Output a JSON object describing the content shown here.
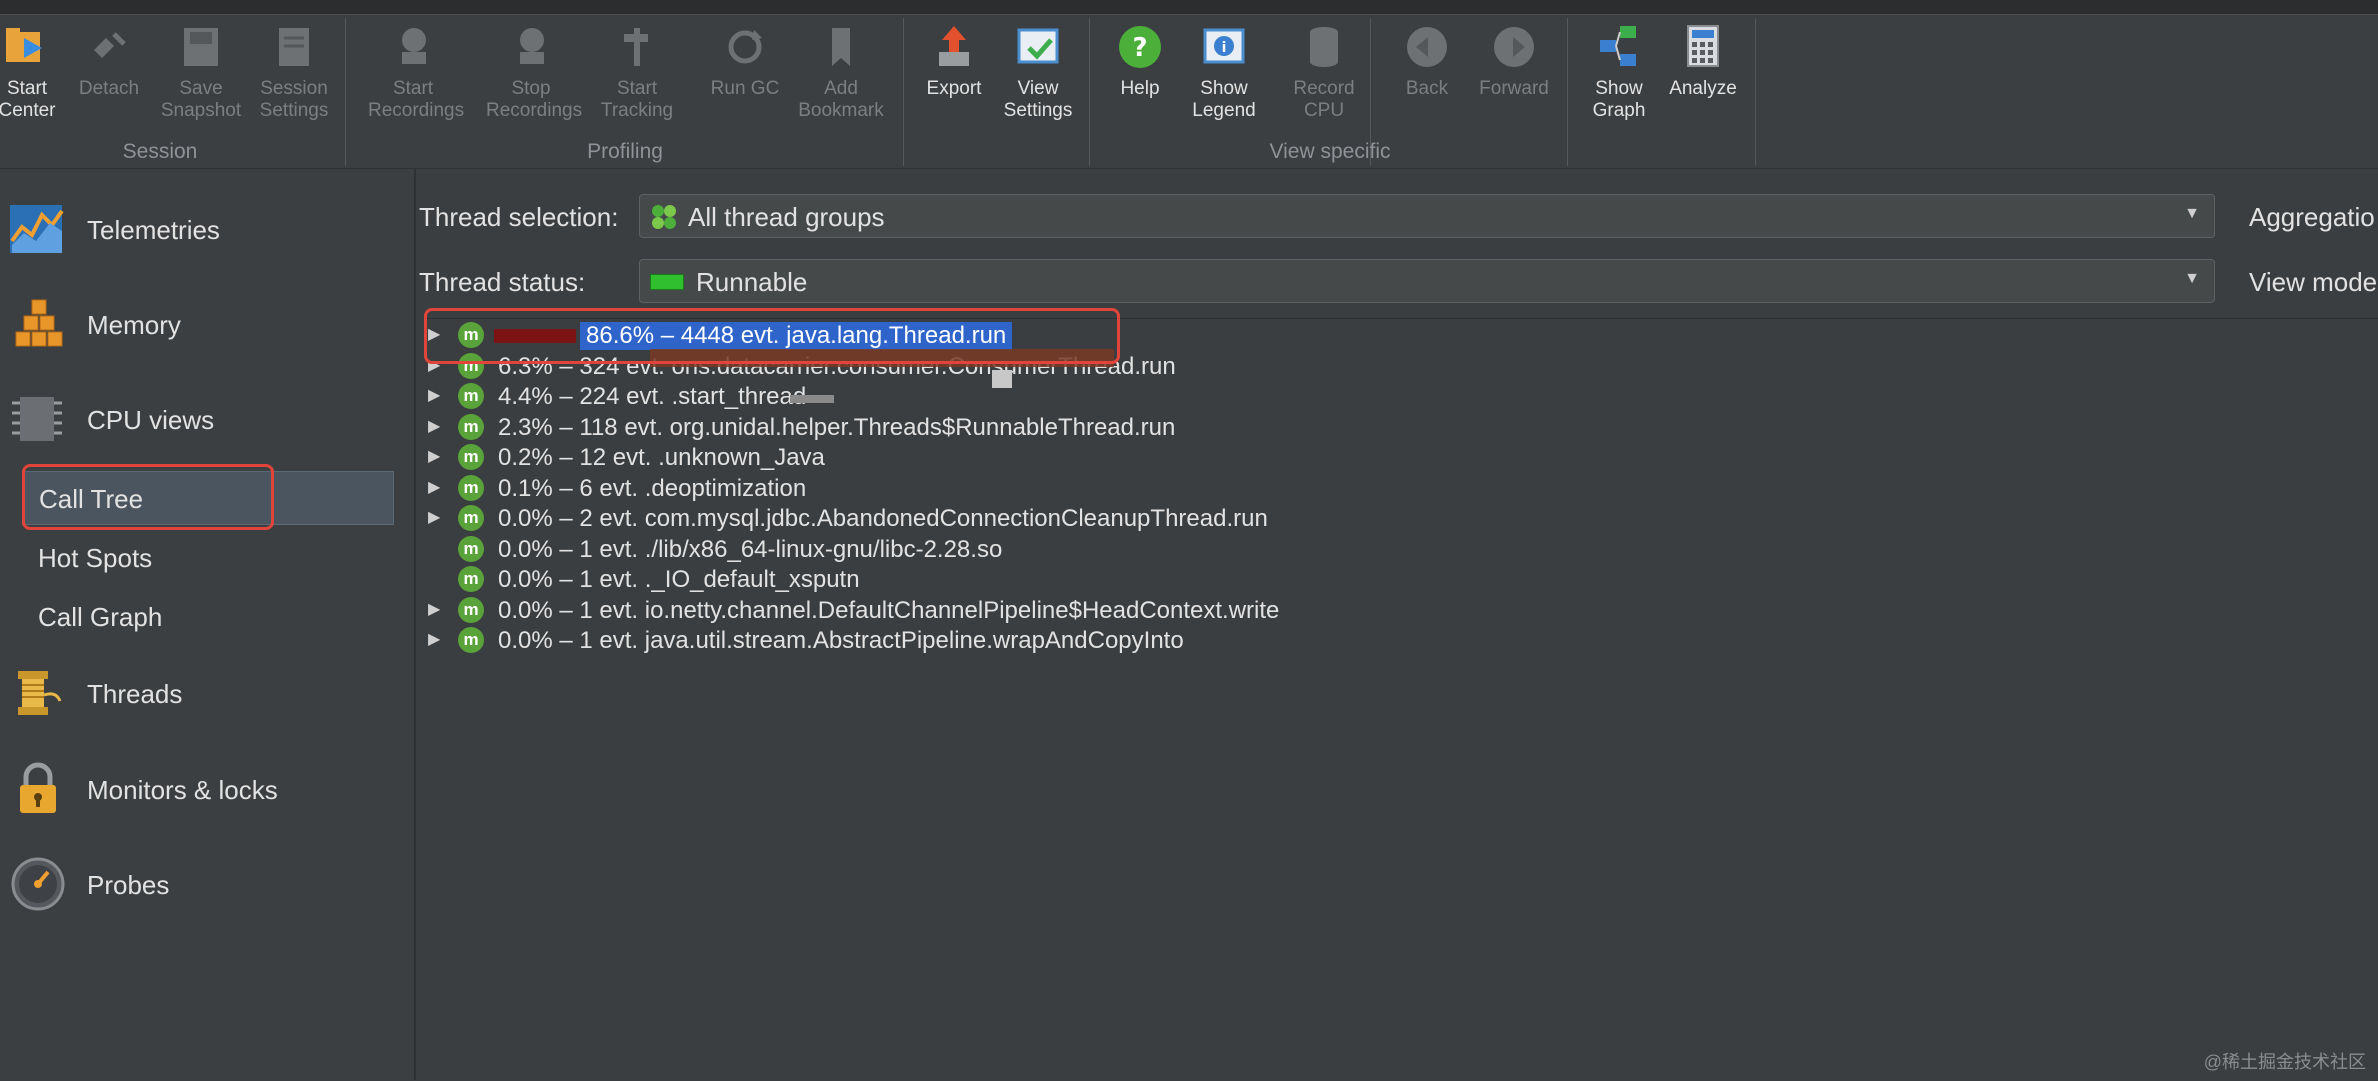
{
  "toolbar": {
    "buttons": [
      {
        "label": "Start\nCenter",
        "icon": "start-center-icon"
      },
      {
        "label": "Detach",
        "icon": "detach-icon"
      },
      {
        "label": "Save\nSnapshot",
        "icon": "save-snapshot-icon"
      },
      {
        "label": "Session\nSettings",
        "icon": "session-settings-icon"
      },
      {
        "label": "Start\nRecordings",
        "icon": "start-recordings-icon"
      },
      {
        "label": "Stop\nRecordings",
        "icon": "stop-recordings-icon"
      },
      {
        "label": "Start\nTracking",
        "icon": "start-tracking-icon"
      },
      {
        "label": "Run GC",
        "icon": "run-gc-icon"
      },
      {
        "label": "Add\nBookmark",
        "icon": "add-bookmark-icon"
      },
      {
        "label": "Export",
        "icon": "export-icon"
      },
      {
        "label": "View\nSettings",
        "icon": "view-settings-icon"
      },
      {
        "label": "Help",
        "icon": "help-icon"
      },
      {
        "label": "Show\nLegend",
        "icon": "show-legend-icon"
      },
      {
        "label": "Record\nCPU",
        "icon": "record-cpu-icon"
      },
      {
        "label": "Back",
        "icon": "back-icon"
      },
      {
        "label": "Forward",
        "icon": "forward-icon"
      },
      {
        "label": "Show\nGraph",
        "icon": "show-graph-icon"
      },
      {
        "label": "Analyze",
        "icon": "analyze-icon"
      }
    ],
    "groups": {
      "session": "Session",
      "profiling": "Profiling",
      "view_specific": "View specific"
    }
  },
  "sidebar": {
    "telemetries": "Telemetries",
    "memory": "Memory",
    "cpu_views": "CPU views",
    "call_tree": "Call Tree",
    "hot_spots": "Hot Spots",
    "call_graph": "Call Graph",
    "threads": "Threads",
    "monitors": "Monitors & locks",
    "probes": "Probes"
  },
  "filters": {
    "thread_selection_label": "Thread selection:",
    "thread_selection_value": "All thread groups",
    "thread_status_label": "Thread status:",
    "thread_status_value": "Runnable",
    "aggregation_label": "Aggregatio",
    "view_mode_label": "View mode"
  },
  "tree": {
    "rows": [
      {
        "text": "86.6% – 4448 evt. java.lang.Thread.run",
        "percent": 86.6,
        "expandable": true
      },
      {
        "text": "6.3% – 324 evt.                                                  ons.datacarrier.consumer.ConsumerThread.run",
        "percent": 6.3,
        "expandable": true
      },
      {
        "text": "4.4% – 224 evt. .start_thread",
        "percent": 4.4,
        "expandable": true
      },
      {
        "text": "2.3% – 118 evt. org.unidal.helper.Threads$RunnableThread.run",
        "percent": 2.3,
        "expandable": true
      },
      {
        "text": "0.2% – 12 evt. .unknown_Java",
        "percent": 0.2,
        "expandable": true
      },
      {
        "text": "0.1% – 6 evt. .deoptimization",
        "percent": 0.1,
        "expandable": true
      },
      {
        "text": "0.0% – 2 evt. com.mysql.jdbc.AbandonedConnectionCleanupThread.run",
        "percent": 0.0,
        "expandable": true
      },
      {
        "text": "0.0% – 1 evt. ./lib/x86_64-linux-gnu/libc-2.28.so",
        "percent": 0.0,
        "expandable": false
      },
      {
        "text": "0.0% – 1 evt. ._IO_default_xsputn",
        "percent": 0.0,
        "expandable": false
      },
      {
        "text": "0.0% – 1 evt. io.netty.channel.DefaultChannelPipeline$HeadContext.write",
        "percent": 0.0,
        "expandable": true
      },
      {
        "text": "0.0% – 1 evt. java.util.stream.AbstractPipeline.wrapAndCopyInto",
        "percent": 0.0,
        "expandable": true
      }
    ],
    "method_badge": "m"
  },
  "watermark": "@稀土掘金技术社区",
  "colors": {
    "highlight": "#2f65ca",
    "annotation": "#e0443a",
    "method_badge": "#5aa33a",
    "bar": "#7a1414"
  }
}
